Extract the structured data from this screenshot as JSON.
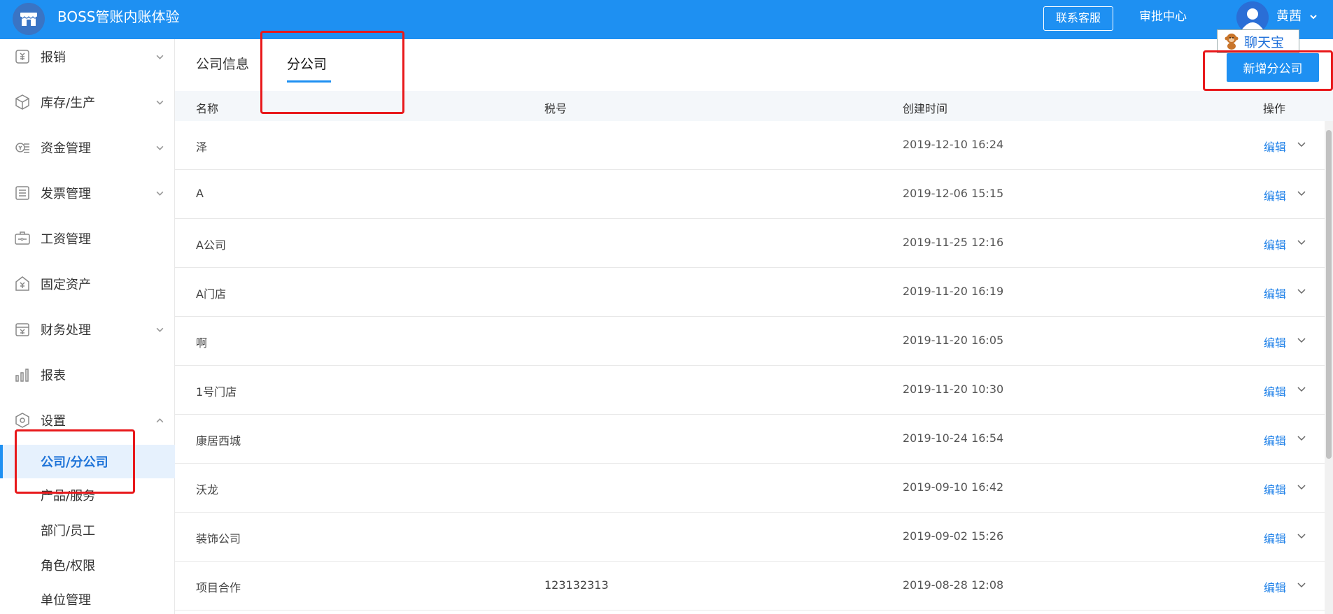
{
  "header": {
    "app_title": "BOSS管账内账体验",
    "support_label": "联系客服",
    "approval_label": "审批中心",
    "username": "黄茜"
  },
  "chat": {
    "label": "聊天宝"
  },
  "sidebar": {
    "items": [
      {
        "label": "报销",
        "icon": "receipt-icon",
        "expandable": true
      },
      {
        "label": "库存/生产",
        "icon": "box-icon",
        "expandable": true
      },
      {
        "label": "资金管理",
        "icon": "money-icon",
        "expandable": true
      },
      {
        "label": "发票管理",
        "icon": "invoice-icon",
        "expandable": true
      },
      {
        "label": "工资管理",
        "icon": "payroll-icon",
        "expandable": false
      },
      {
        "label": "固定资产",
        "icon": "asset-icon",
        "expandable": false
      },
      {
        "label": "财务处理",
        "icon": "finance-icon",
        "expandable": true
      },
      {
        "label": "报表",
        "icon": "bar-chart-icon",
        "expandable": false
      },
      {
        "label": "设置",
        "icon": "settings-icon",
        "expandable": true,
        "expanded": true
      }
    ],
    "settings_sub": [
      {
        "label": "公司/分公司",
        "active": true
      },
      {
        "label": "产品/服务"
      },
      {
        "label": "部门/员工"
      },
      {
        "label": "角色/权限"
      },
      {
        "label": "单位管理"
      }
    ]
  },
  "tabs": [
    {
      "label": "公司信息"
    },
    {
      "label": "分公司",
      "active": true
    }
  ],
  "add_branch_label": "新增分公司",
  "table": {
    "columns": [
      "名称",
      "税号",
      "创建时间",
      "操作"
    ],
    "rows": [
      {
        "name": "泽",
        "tax_id": "",
        "created": "2019-12-10 16:24",
        "action": "编辑"
      },
      {
        "name": "A",
        "tax_id": "",
        "created": "2019-12-06 15:15",
        "action": "编辑"
      },
      {
        "name": "A公司",
        "tax_id": "",
        "created": "2019-11-25 12:16",
        "action": "编辑"
      },
      {
        "name": "A门店",
        "tax_id": "",
        "created": "2019-11-20 16:19",
        "action": "编辑"
      },
      {
        "name": "啊",
        "tax_id": "",
        "created": "2019-11-20 16:05",
        "action": "编辑"
      },
      {
        "name": "1号门店",
        "tax_id": "",
        "created": "2019-11-20 10:30",
        "action": "编辑"
      },
      {
        "name": "康居西城",
        "tax_id": "",
        "created": "2019-10-24 16:54",
        "action": "编辑"
      },
      {
        "name": "沃龙",
        "tax_id": "",
        "created": "2019-09-10 16:42",
        "action": "编辑"
      },
      {
        "name": "装饰公司",
        "tax_id": "",
        "created": "2019-09-02 15:26",
        "action": "编辑"
      },
      {
        "name": "项目合作",
        "tax_id": "123132313",
        "created": "2019-08-28 12:08",
        "action": "编辑"
      }
    ]
  },
  "colors": {
    "primary": "#1e90f2",
    "highlight": "#e8191c",
    "link": "#1e80e8"
  }
}
